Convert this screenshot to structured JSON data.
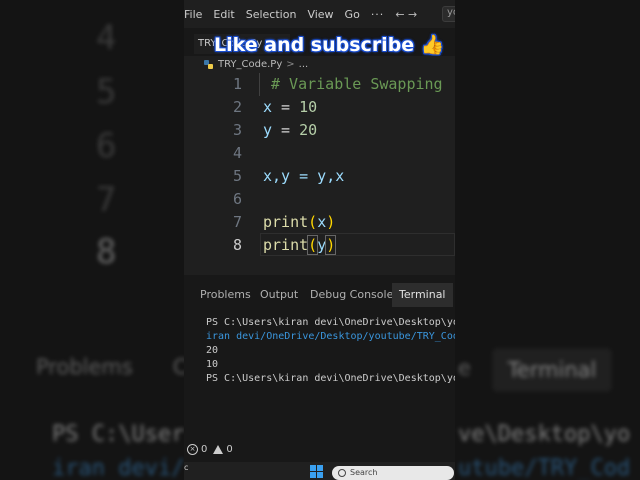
{
  "background": {
    "line_numbers": [
      "4",
      "5",
      "6",
      "7",
      "8"
    ],
    "tabs_left": "Problems",
    "tabs_partial": "C",
    "tabs_e": "e",
    "terminal_tab": "Terminal",
    "line1_left": "PS C:\\User",
    "line1_right": "ve\\Desktop\\yo",
    "line2_left": "iran devi/",
    "line2_right": "utube/TRY_Cod"
  },
  "menubar": {
    "items": [
      "File",
      "Edit",
      "Selection",
      "View",
      "Go"
    ],
    "dots": "···",
    "arrows": "←  →",
    "search_text": "yo"
  },
  "tab": {
    "label": "TRY_Code.Py"
  },
  "overlay": {
    "text": "Like and subscribe",
    "emoji": "👍"
  },
  "breadcrumb": {
    "file": "TRY_Code.Py",
    "sep": ">",
    "rest": "..."
  },
  "editor": {
    "lines": [
      {
        "num": "1",
        "comment": "# Variable Swapping"
      },
      {
        "num": "2",
        "var": "x",
        "op": " = ",
        "val": "10"
      },
      {
        "num": "3",
        "var": "y",
        "op": " = ",
        "val": "20"
      },
      {
        "num": "4"
      },
      {
        "num": "5",
        "text": "x,y = y,x"
      },
      {
        "num": "6"
      },
      {
        "num": "7",
        "fn": "print",
        "arg": "x"
      },
      {
        "num": "8",
        "fn": "print",
        "arg": "y"
      }
    ]
  },
  "panel_tabs": [
    "Problems",
    "Output",
    "Debug Console",
    "Terminal"
  ],
  "terminal": {
    "lines": [
      "PS C:\\Users\\kiran devi\\OneDrive\\Desktop\\yo",
      "iran devi/OneDrive/Desktop/youtube/TRY_Cod",
      "20",
      "10",
      "PS C:\\Users\\kiran devi\\OneDrive\\Desktop\\yo"
    ]
  },
  "statusbar": {
    "errors": "0",
    "warnings": "0"
  },
  "taskbar": {
    "search_placeholder": "Search",
    "left_char": "c"
  }
}
